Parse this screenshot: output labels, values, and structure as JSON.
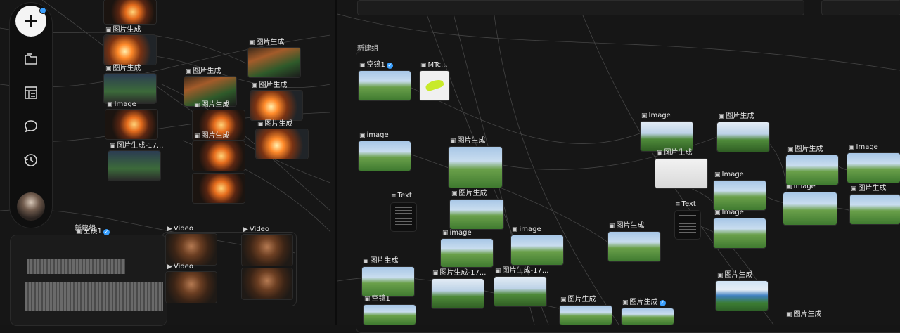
{
  "sidebar": {
    "add_button_label": "+",
    "icons": [
      "folder-icon",
      "layout-icon",
      "chat-bubble-icon",
      "history-icon"
    ],
    "avatar_icon": "user-avatar"
  },
  "groups": {
    "left_group_title": "新建组",
    "right_group_title": "新建组"
  },
  "left_nodes": [
    {
      "label": "图片生成"
    },
    {
      "label": "图片生成"
    },
    {
      "label": "图片生成"
    },
    {
      "label": "图片生成"
    },
    {
      "label": "图片生成"
    },
    {
      "label": "Image"
    },
    {
      "label": "图片生成"
    },
    {
      "label": "图片生成"
    },
    {
      "label": "图片生成-17..."
    },
    {
      "label": "图片生成"
    },
    {
      "label": "图片生成"
    }
  ],
  "video_nodes": [
    {
      "label": "Video"
    },
    {
      "label": "Video"
    },
    {
      "label": "Video"
    }
  ],
  "left_group_badge": "空镜1",
  "right_nodes": [
    {
      "label": "空镜1",
      "verified": true
    },
    {
      "label": "MTc..."
    },
    {
      "label": "image"
    },
    {
      "label": "图片生成"
    },
    {
      "label": "Text"
    },
    {
      "label": "图片生成"
    },
    {
      "label": "image"
    },
    {
      "label": "image"
    },
    {
      "label": "图片生成"
    },
    {
      "label": "图片生成-17..."
    },
    {
      "label": "图片生成-17..."
    },
    {
      "label": "空镜1"
    },
    {
      "label": "图片生成"
    },
    {
      "label": "图片生成",
      "verified": true
    },
    {
      "label": "Image"
    },
    {
      "label": "图片生成"
    },
    {
      "label": "图片生成"
    },
    {
      "label": "Image"
    },
    {
      "label": "Text"
    },
    {
      "label": "Image"
    },
    {
      "label": "图片生成"
    },
    {
      "label": "Image"
    },
    {
      "label": "图片生成"
    },
    {
      "label": "图片生成"
    },
    {
      "label": "图片生成"
    },
    {
      "label": "Image"
    }
  ],
  "colors": {
    "accent": "#3aa0ff",
    "canvas": "#161616",
    "panel": "#0f0f0f"
  }
}
